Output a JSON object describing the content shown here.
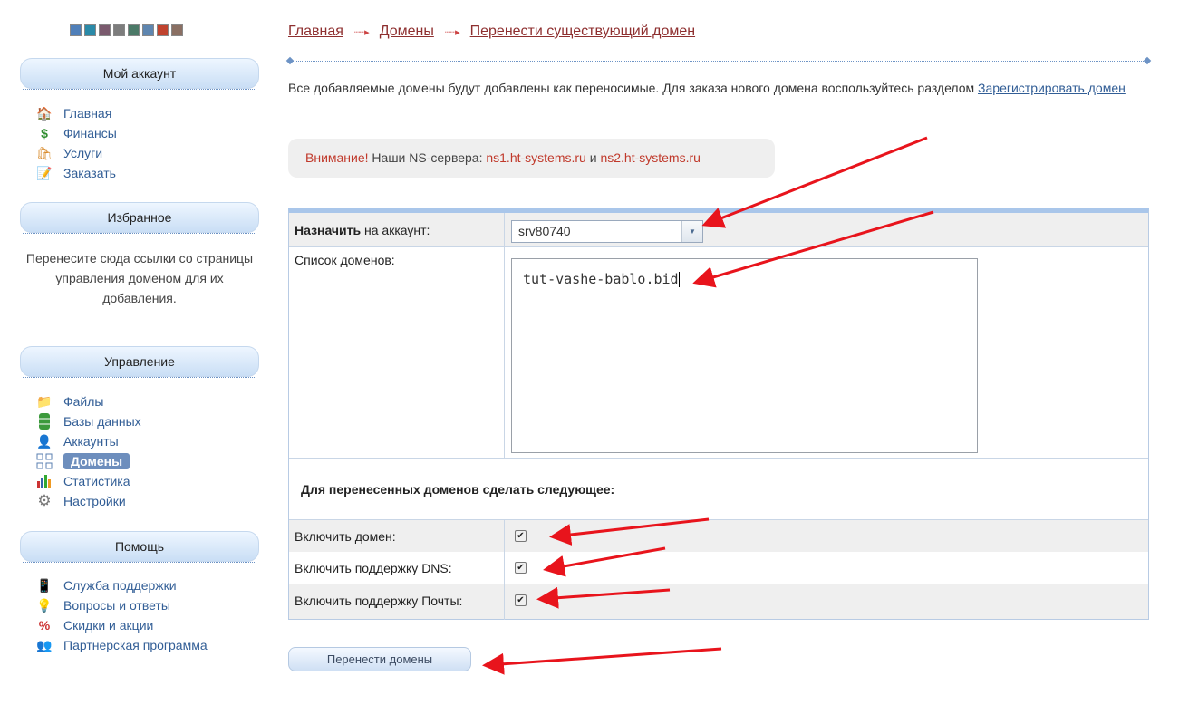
{
  "colors": {
    "link": "#325e96",
    "breadcrumb_link": "#8e2f2f",
    "warning": "#c0392b",
    "annotation_arrow": "#e8141c",
    "swatches": [
      "#4f7fb9",
      "#2a8aa8",
      "#7a5a6e",
      "#7d7d7d",
      "#4c7a68",
      "#5e86b0",
      "#c0432e",
      "#8a6f63"
    ]
  },
  "sidebar": {
    "account": {
      "title": "Мой аккаунт",
      "items": [
        {
          "label": "Главная",
          "icon": "home-icon"
        },
        {
          "label": "Финансы",
          "icon": "dollar-icon"
        },
        {
          "label": "Услуги",
          "icon": "basket-icon"
        },
        {
          "label": "Заказать",
          "icon": "order-form-icon"
        }
      ]
    },
    "favorites": {
      "title": "Избранное",
      "text": "Перенесите сюда ссылки со страницы управления доменом для их добавления."
    },
    "management": {
      "title": "Управление",
      "items": [
        {
          "label": "Файлы",
          "icon": "folder-icon"
        },
        {
          "label": "Базы данных",
          "icon": "database-icon"
        },
        {
          "label": "Аккаунты",
          "icon": "user-icon"
        },
        {
          "label": "Домены",
          "icon": "domains-grid-icon",
          "active": true
        },
        {
          "label": "Статистика",
          "icon": "bar-chart-icon"
        },
        {
          "label": "Настройки",
          "icon": "gear-icon"
        }
      ]
    },
    "help": {
      "title": "Помощь",
      "items": [
        {
          "label": "Служба поддержки",
          "icon": "phone-icon"
        },
        {
          "label": "Вопросы и ответы",
          "icon": "lightbulb-icon"
        },
        {
          "label": "Скидки и акции",
          "icon": "discount-icon"
        },
        {
          "label": "Партнерская программа",
          "icon": "partners-icon"
        }
      ]
    }
  },
  "breadcrumb": [
    "Главная",
    "Домены",
    "Перенести существующий домен"
  ],
  "intro": {
    "text": "Все добавляемые домены будут добавлены как переносимые. Для заказа нового домена воспользуйтесь разделом ",
    "link": "Зарегистрировать домен"
  },
  "notice": {
    "warning": "Внимание!",
    "text1": " Наши NS-сервера: ",
    "ns1": "ns1.ht-systems.ru",
    "and": " и ",
    "ns2": "ns2.ht-systems.ru"
  },
  "form": {
    "account_label_bold": "Назначить",
    "account_label_rest": " на аккаунт:",
    "account_value": "srv80740",
    "domains_label": "Список доменов:",
    "domains_value": "tut-vashe-bablo.bid",
    "section_title": "Для перенесенных доменов сделать следующее:",
    "options": [
      {
        "label": "Включить домен:",
        "checked": true
      },
      {
        "label": "Включить поддержку DNS:",
        "checked": true
      },
      {
        "label": "Включить поддержку Почты:",
        "checked": true
      }
    ],
    "submit_label": "Перенести домены"
  }
}
